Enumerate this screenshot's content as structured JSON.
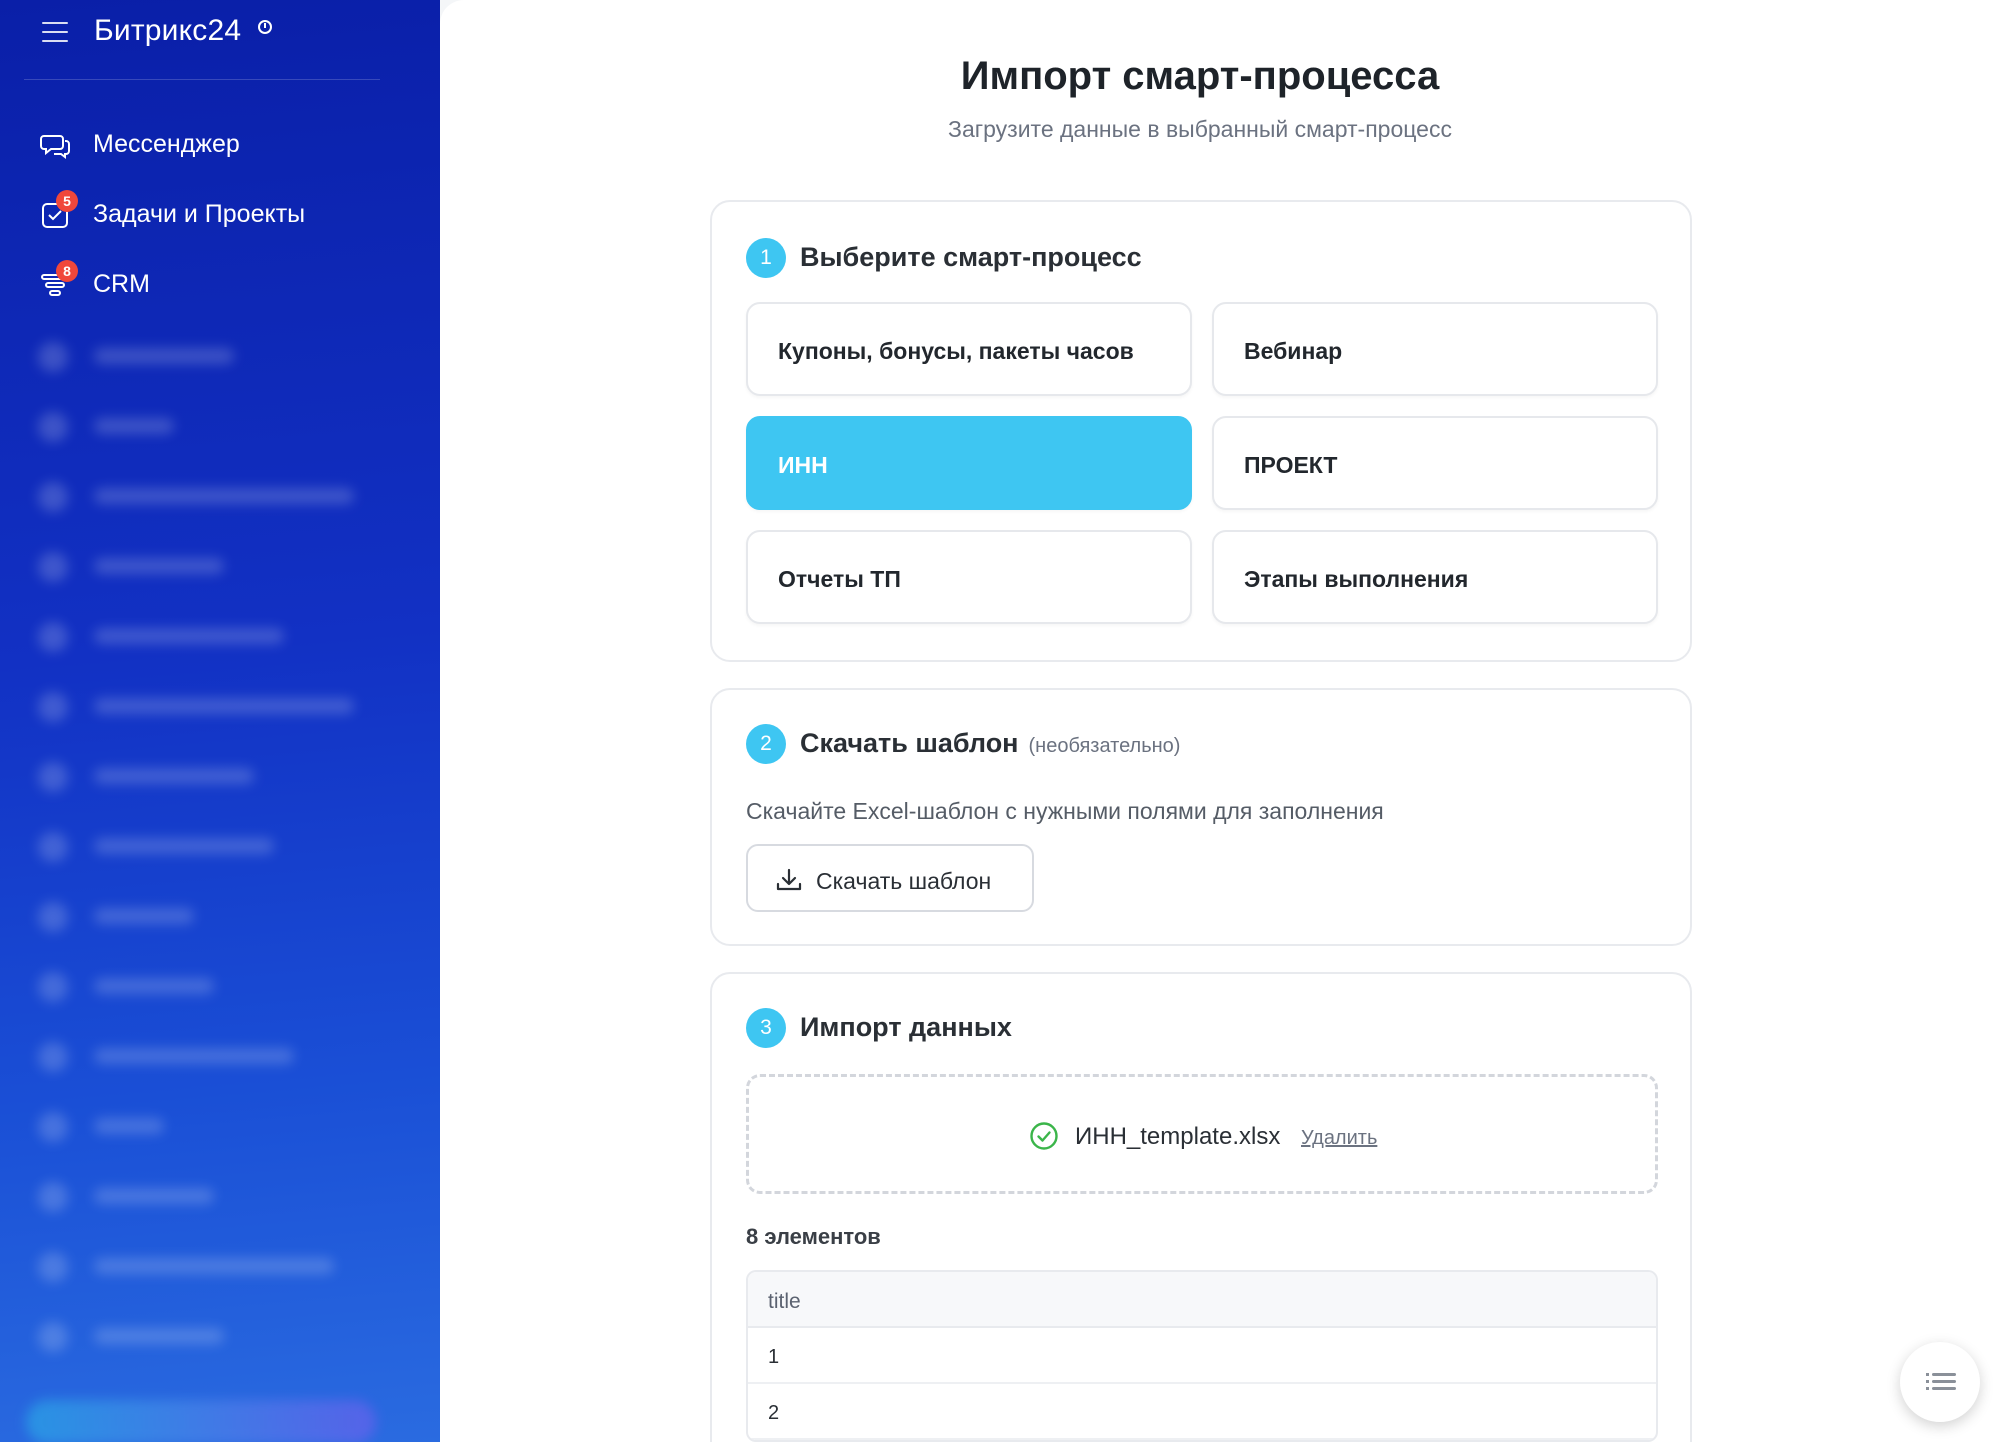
{
  "sidebar": {
    "brand": "Битрикс24",
    "items": [
      {
        "label": "Мессенджер",
        "badge": null
      },
      {
        "label": "Задачи и Проекты",
        "badge": "5"
      },
      {
        "label": "CRM",
        "badge": "8"
      }
    ]
  },
  "page": {
    "title": "Импорт смарт-процесса",
    "subtitle": "Загрузите данные в выбранный смарт-процесс"
  },
  "step1": {
    "number": "1",
    "title": "Выберите смарт-процесс",
    "options": [
      "Купоны, бонусы, пакеты часов",
      "Вебинар",
      "ИНН",
      "ПРОЕКТ",
      "Отчеты ТП",
      "Этапы выполнения"
    ],
    "selected": "ИНН"
  },
  "step2": {
    "number": "2",
    "title": "Скачать шаблон",
    "note": "(необязательно)",
    "description": "Скачайте Excel-шаблон с нужными полями для заполнения",
    "button_label": "Скачать шаблон"
  },
  "step3": {
    "number": "3",
    "title": "Импорт данных",
    "file_name": "ИНН_template.xlsx",
    "delete_label": "Удалить",
    "count_label": "8 элементов",
    "table": {
      "column": "title",
      "rows": [
        "1",
        "2"
      ]
    }
  },
  "colors": {
    "accent": "#3ec6f2",
    "sidebar": "#1231c4",
    "badge": "#f0473b",
    "success": "#3bb54a"
  }
}
